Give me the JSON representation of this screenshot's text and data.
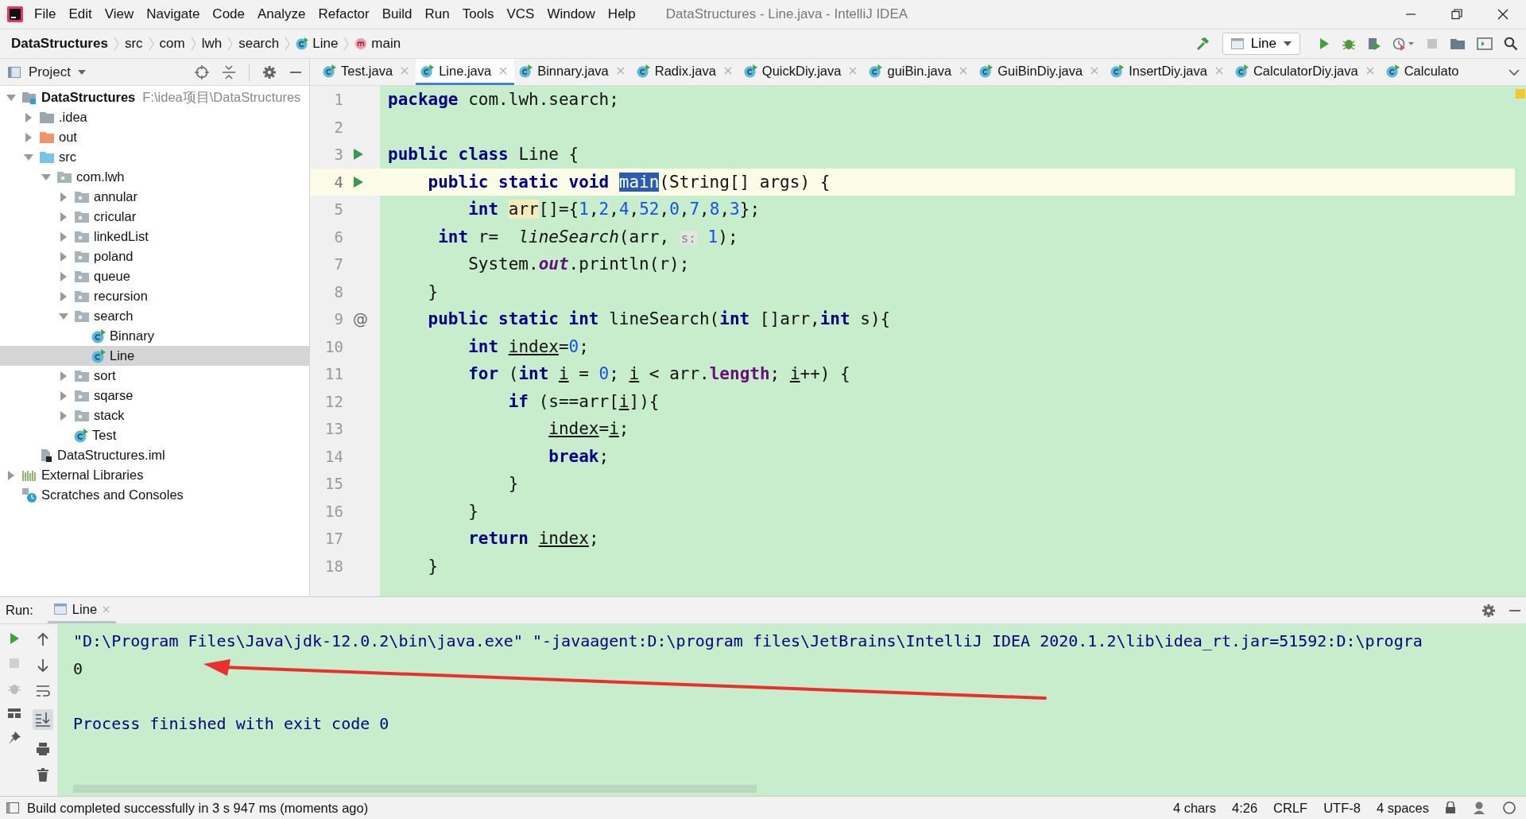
{
  "window": {
    "title": "DataStructures - Line.java - IntelliJ IDEA"
  },
  "menu": [
    "File",
    "Edit",
    "View",
    "Navigate",
    "Code",
    "Analyze",
    "Refactor",
    "Build",
    "Run",
    "Tools",
    "VCS",
    "Window",
    "Help"
  ],
  "breadcrumbs": [
    {
      "label": "DataStructures",
      "kind": "project"
    },
    {
      "label": "src",
      "kind": "folder"
    },
    {
      "label": "com",
      "kind": "folder"
    },
    {
      "label": "lwh",
      "kind": "folder"
    },
    {
      "label": "search",
      "kind": "folder"
    },
    {
      "label": "Line",
      "kind": "class"
    },
    {
      "label": "main",
      "kind": "method"
    }
  ],
  "run_config": {
    "label": "Line"
  },
  "project": {
    "title": "Project",
    "tree": [
      {
        "label": "DataStructures",
        "path": "F:\\idea项目\\DataStructures",
        "kind": "module",
        "expanded": true,
        "selected": false,
        "children": [
          {
            "label": ".idea",
            "kind": "folder",
            "expanded": false,
            "selected": false
          },
          {
            "label": "out",
            "kind": "excluded",
            "expanded": false,
            "selected": false
          },
          {
            "label": "src",
            "kind": "source",
            "expanded": true,
            "selected": false,
            "children": [
              {
                "label": "com.lwh",
                "kind": "package",
                "expanded": true,
                "selected": false,
                "children": [
                  {
                    "label": "annular",
                    "kind": "package",
                    "expanded": false,
                    "selected": false
                  },
                  {
                    "label": "cricular",
                    "kind": "package",
                    "expanded": false,
                    "selected": false
                  },
                  {
                    "label": "linkedList",
                    "kind": "package",
                    "expanded": false,
                    "selected": false
                  },
                  {
                    "label": "poland",
                    "kind": "package",
                    "expanded": false,
                    "selected": false
                  },
                  {
                    "label": "queue",
                    "kind": "package",
                    "expanded": false,
                    "selected": false
                  },
                  {
                    "label": "recursion",
                    "kind": "package",
                    "expanded": false,
                    "selected": false
                  },
                  {
                    "label": "search",
                    "kind": "package",
                    "expanded": true,
                    "selected": false,
                    "children": [
                      {
                        "label": "Binnary",
                        "kind": "class",
                        "selected": false
                      },
                      {
                        "label": "Line",
                        "kind": "class",
                        "selected": true
                      }
                    ]
                  },
                  {
                    "label": "sort",
                    "kind": "package",
                    "expanded": false,
                    "selected": false
                  },
                  {
                    "label": "sqarse",
                    "kind": "package",
                    "expanded": false,
                    "selected": false
                  },
                  {
                    "label": "stack",
                    "kind": "package",
                    "expanded": false,
                    "selected": false
                  },
                  {
                    "label": "Test",
                    "kind": "class",
                    "selected": false
                  }
                ]
              }
            ]
          },
          {
            "label": "DataStructures.iml",
            "kind": "iml",
            "selected": false
          }
        ]
      },
      {
        "label": "External Libraries",
        "kind": "libraries",
        "expanded": false,
        "selected": false
      },
      {
        "label": "Scratches and Consoles",
        "kind": "scratches",
        "selected": false
      }
    ]
  },
  "tabs": [
    {
      "label": "Test.java",
      "selected": false,
      "closable": true
    },
    {
      "label": "Line.java",
      "selected": true,
      "closable": true
    },
    {
      "label": "Binnary.java",
      "selected": false,
      "closable": true
    },
    {
      "label": "Radix.java",
      "selected": false,
      "closable": true
    },
    {
      "label": "QuickDiy.java",
      "selected": false,
      "closable": true
    },
    {
      "label": "guiBin.java",
      "selected": false,
      "closable": true
    },
    {
      "label": "GuiBinDiy.java",
      "selected": false,
      "closable": true
    },
    {
      "label": "InsertDiy.java",
      "selected": false,
      "closable": true
    },
    {
      "label": "CalculatorDiy.java",
      "selected": false,
      "closable": true
    },
    {
      "label": "Calculato",
      "selected": false,
      "closable": false
    }
  ],
  "editor": {
    "lines": [
      {
        "number": "1",
        "kind": "plain",
        "current": false,
        "tokens": [
          {
            "kind": "kw",
            "text": "package"
          },
          {
            "kind": "plain",
            "text": " com.lwh.search;"
          }
        ]
      },
      {
        "number": "2",
        "kind": "plain",
        "current": false
      },
      {
        "number": "3",
        "kind": "run",
        "current": false,
        "tokens": [
          {
            "kind": "kw",
            "text": "public class"
          },
          {
            "kind": "plain",
            "text": " Line {"
          }
        ]
      },
      {
        "number": "4",
        "kind": "run",
        "current": true,
        "tokens": [
          {
            "kind": "kw",
            "text": "    public static void "
          },
          {
            "kind": "sel",
            "text": "main"
          },
          {
            "kind": "plain",
            "text": "(String[] args) {"
          }
        ]
      },
      {
        "number": "5",
        "kind": "plain",
        "current": false,
        "tokens": [
          {
            "kind": "kw",
            "text": "        int "
          },
          {
            "kind": "mark",
            "text": "arr"
          },
          {
            "kind": "plain",
            "text": "[]={"
          },
          {
            "kind": "num",
            "text": "1"
          },
          {
            "kind": "plain",
            "text": ","
          },
          {
            "kind": "num",
            "text": "2"
          },
          {
            "kind": "plain",
            "text": ","
          },
          {
            "kind": "num",
            "text": "4"
          },
          {
            "kind": "plain",
            "text": ","
          },
          {
            "kind": "num",
            "text": "52"
          },
          {
            "kind": "plain",
            "text": ","
          },
          {
            "kind": "num",
            "text": "0"
          },
          {
            "kind": "plain",
            "text": ","
          },
          {
            "kind": "num",
            "text": "7"
          },
          {
            "kind": "plain",
            "text": ","
          },
          {
            "kind": "num",
            "text": "8"
          },
          {
            "kind": "plain",
            "text": ","
          },
          {
            "kind": "num",
            "text": "3"
          },
          {
            "kind": "plain",
            "text": "};"
          }
        ]
      },
      {
        "number": "6",
        "kind": "plain",
        "current": false,
        "tokens": [
          {
            "kind": "kw",
            "text": "     int"
          },
          {
            "kind": "plain",
            "text": " r=  "
          },
          {
            "kind": "call",
            "text": "lineSearch"
          },
          {
            "kind": "plain",
            "text": "(arr, "
          },
          {
            "kind": "hint",
            "text": "s:"
          },
          {
            "kind": "num",
            "text": " 1"
          },
          {
            "kind": "plain",
            "text": ");"
          }
        ]
      },
      {
        "number": "7",
        "kind": "plain",
        "current": false,
        "tokens": [
          {
            "kind": "plain",
            "text": "        System."
          },
          {
            "kind": "field",
            "text": "out"
          },
          {
            "kind": "plain",
            "text": ".println(r);"
          }
        ]
      },
      {
        "number": "8",
        "kind": "plain",
        "current": false,
        "tokens": [
          {
            "kind": "plain",
            "text": "    }"
          }
        ]
      },
      {
        "number": "9",
        "kind": "mark",
        "mark": "@",
        "current": false,
        "tokens": [
          {
            "kind": "kw",
            "text": "    public static int"
          },
          {
            "kind": "plain",
            "text": " lineSearch("
          },
          {
            "kind": "kw",
            "text": "int"
          },
          {
            "kind": "plain",
            "text": " []arr,"
          },
          {
            "kind": "kw",
            "text": "int"
          },
          {
            "kind": "plain",
            "text": " s){"
          }
        ]
      },
      {
        "number": "10",
        "kind": "plain",
        "current": false,
        "tokens": [
          {
            "kind": "kw",
            "text": "        int "
          },
          {
            "kind": "ul",
            "text": "index"
          },
          {
            "kind": "plain",
            "text": "="
          },
          {
            "kind": "num",
            "text": "0"
          },
          {
            "kind": "plain",
            "text": ";"
          }
        ]
      },
      {
        "number": "11",
        "kind": "plain",
        "current": false,
        "tokens": [
          {
            "kind": "kw",
            "text": "        for"
          },
          {
            "kind": "plain",
            "text": " ("
          },
          {
            "kind": "kw",
            "text": "int "
          },
          {
            "kind": "ul",
            "text": "i"
          },
          {
            "kind": "plain",
            "text": " = "
          },
          {
            "kind": "num",
            "text": "0"
          },
          {
            "kind": "plain",
            "text": "; "
          },
          {
            "kind": "ul",
            "text": "i"
          },
          {
            "kind": "plain",
            "text": " < arr."
          },
          {
            "kind": "member",
            "text": "length"
          },
          {
            "kind": "plain",
            "text": "; "
          },
          {
            "kind": "ul",
            "text": "i"
          },
          {
            "kind": "plain",
            "text": "++) {"
          }
        ]
      },
      {
        "number": "12",
        "kind": "plain",
        "current": false,
        "tokens": [
          {
            "kind": "kw",
            "text": "            if"
          },
          {
            "kind": "plain",
            "text": " (s==arr["
          },
          {
            "kind": "ul",
            "text": "i"
          },
          {
            "kind": "plain",
            "text": "]){"
          }
        ]
      },
      {
        "number": "13",
        "kind": "plain",
        "current": false,
        "tokens": [
          {
            "kind": "ul",
            "text": "                index"
          },
          {
            "kind": "plain",
            "text": "="
          },
          {
            "kind": "ul",
            "text": "i"
          },
          {
            "kind": "plain",
            "text": ";"
          }
        ]
      },
      {
        "number": "14",
        "kind": "plain",
        "current": false,
        "tokens": [
          {
            "kind": "kw",
            "text": "                break"
          },
          {
            "kind": "plain",
            "text": ";"
          }
        ]
      },
      {
        "number": "15",
        "kind": "plain",
        "current": false,
        "tokens": [
          {
            "kind": "plain",
            "text": "            }"
          }
        ]
      },
      {
        "number": "16",
        "kind": "plain",
        "current": false,
        "tokens": [
          {
            "kind": "plain",
            "text": "        }"
          }
        ]
      },
      {
        "number": "17",
        "kind": "plain",
        "current": false,
        "tokens": [
          {
            "kind": "kw",
            "text": "        return "
          },
          {
            "kind": "ul",
            "text": "index"
          },
          {
            "kind": "plain",
            "text": ";"
          }
        ]
      },
      {
        "number": "18",
        "kind": "plain",
        "current": false,
        "tokens": [
          {
            "kind": "plain",
            "text": "    }"
          }
        ]
      }
    ]
  },
  "run": {
    "label": "Run:",
    "tabs": [
      {
        "label": "Line",
        "selected": true
      }
    ],
    "output": [
      {
        "kind": "command",
        "text": "\"D:\\Program Files\\Java\\jdk-12.0.2\\bin\\java.exe\" \"-javaagent:D:\\program files\\JetBrains\\IntelliJ IDEA 2020.1.2\\lib\\idea_rt.jar=51592:D:\\progra"
      },
      {
        "kind": "stdout",
        "text": "0"
      },
      {
        "kind": "blank"
      },
      {
        "kind": "info",
        "text": "Process finished with exit code 0"
      }
    ]
  },
  "status_bar": {
    "message": "Build completed successfully in 3 s 947 ms (moments ago)",
    "items": [
      "4 chars",
      "4:26",
      "CRLF",
      "UTF-8",
      "4 spaces"
    ]
  }
}
